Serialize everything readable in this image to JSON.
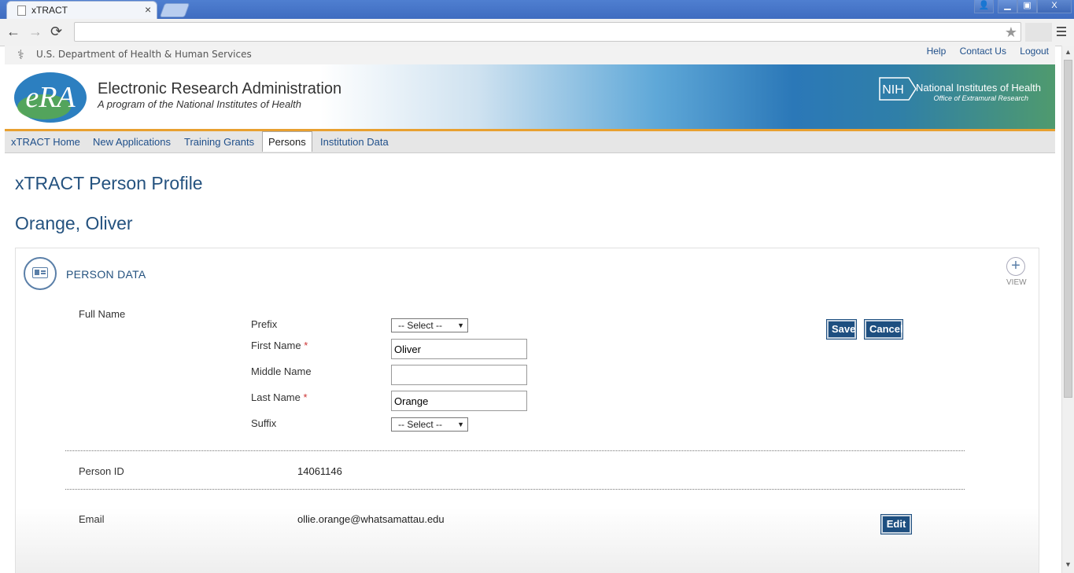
{
  "browser": {
    "tab_title": "xTRACT",
    "tab_close": "×",
    "back": "←",
    "forward": "→",
    "reload": "⟳",
    "star": "★",
    "win_user": "👤",
    "win_min": "▁",
    "win_max": "▣",
    "win_close": "X"
  },
  "header": {
    "hhs_text": "U.S. Department of Health & Human Services",
    "links": [
      "Help",
      "Contact Us",
      "Logout"
    ],
    "banner_title": "Electronic Research Administration",
    "banner_subtitle": "A program of the National Institutes of Health",
    "logo_text": "eRA",
    "nih_badge": "NIH",
    "nih_name": "National Institutes of Health",
    "nih_sub": "Office of Extramural Research"
  },
  "nav": {
    "items": [
      "xTRACT Home",
      "New Applications",
      "Training Grants",
      "Persons",
      "Institution Data"
    ],
    "active": "Persons"
  },
  "page": {
    "title": "xTRACT Person Profile",
    "person_name": "Orange, Oliver"
  },
  "panel": {
    "title": "PERSON DATA",
    "view_label": "VIEW",
    "full_name_label": "Full Name",
    "fields": {
      "prefix_label": "Prefix",
      "prefix_value": "-- Select --",
      "first_label": "First Name",
      "first_value": "Oliver",
      "middle_label": "Middle Name",
      "middle_value": "",
      "last_label": "Last Name",
      "last_value": "Orange",
      "suffix_label": "Suffix",
      "suffix_value": "-- Select --",
      "required_mark": "*"
    },
    "save_label": "Save",
    "cancel_label": "Cancel",
    "person_id_label": "Person ID",
    "person_id_value": "14061146",
    "email_label": "Email",
    "email_value": "ollie.orange@whatsamattau.edu",
    "edit_label": "Edit"
  },
  "colors": {
    "brand_blue": "#24527f",
    "button_blue": "#1e4f80",
    "banner_accent": "#e8a030"
  }
}
